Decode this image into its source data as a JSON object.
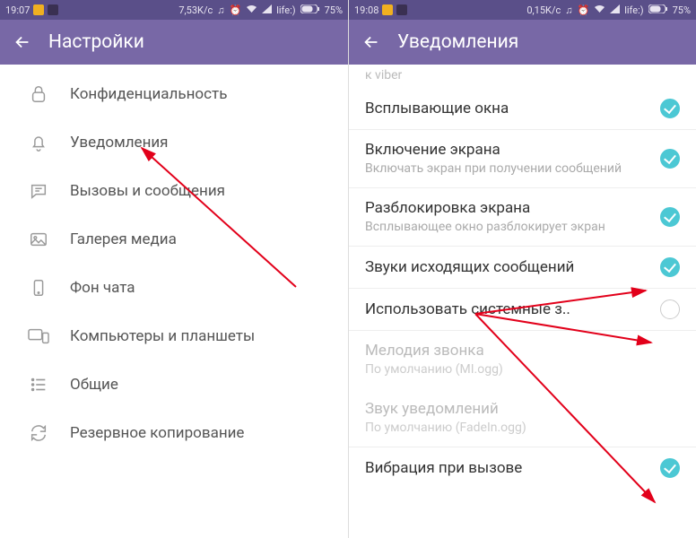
{
  "left": {
    "status": {
      "time": "19:07",
      "speed": "7,53K/c",
      "carrier": "life:)",
      "battery": "75%"
    },
    "title": "Настройки",
    "items": [
      {
        "label": "Конфиденциальность",
        "icon": "lock-icon"
      },
      {
        "label": "Уведомления",
        "icon": "bell-icon"
      },
      {
        "label": "Вызовы и сообщения",
        "icon": "chat-icon"
      },
      {
        "label": "Галерея медиа",
        "icon": "image-icon"
      },
      {
        "label": "Фон чата",
        "icon": "phone-icon"
      },
      {
        "label": "Компьютеры и планшеты",
        "icon": "devices-icon"
      },
      {
        "label": "Общие",
        "icon": "list-icon"
      },
      {
        "label": "Резервное копирование",
        "icon": "sync-icon"
      }
    ]
  },
  "right": {
    "status": {
      "time": "19:08",
      "speed": "0,15K/c",
      "carrier": "life:)",
      "battery": "75%"
    },
    "title": "Уведомления",
    "partial_above": "к viber",
    "settings": [
      {
        "title": "Всплывающие окна",
        "sub": "",
        "checked": true,
        "disabled": false
      },
      {
        "title": "Включение экрана",
        "sub": "Включать экран при получении сообщений",
        "checked": true,
        "disabled": false
      },
      {
        "title": "Разблокировка экрана",
        "sub": "Всплывающее окно разблокирует экран",
        "checked": true,
        "disabled": false
      },
      {
        "title": "Звуки исходящих сообщений",
        "sub": "",
        "checked": true,
        "disabled": false
      },
      {
        "title": "Использовать системные з..",
        "sub": "",
        "checked": false,
        "disabled": false
      },
      {
        "title": "Мелодия звонка",
        "sub": "По умолчанию (MI.ogg)",
        "checked": null,
        "disabled": true
      },
      {
        "title": "Звук уведомлений",
        "sub": "По умолчанию (FadeIn.ogg)",
        "checked": null,
        "disabled": true
      },
      {
        "title": "Вибрация при вызове",
        "sub": "",
        "checked": true,
        "disabled": false
      }
    ]
  }
}
